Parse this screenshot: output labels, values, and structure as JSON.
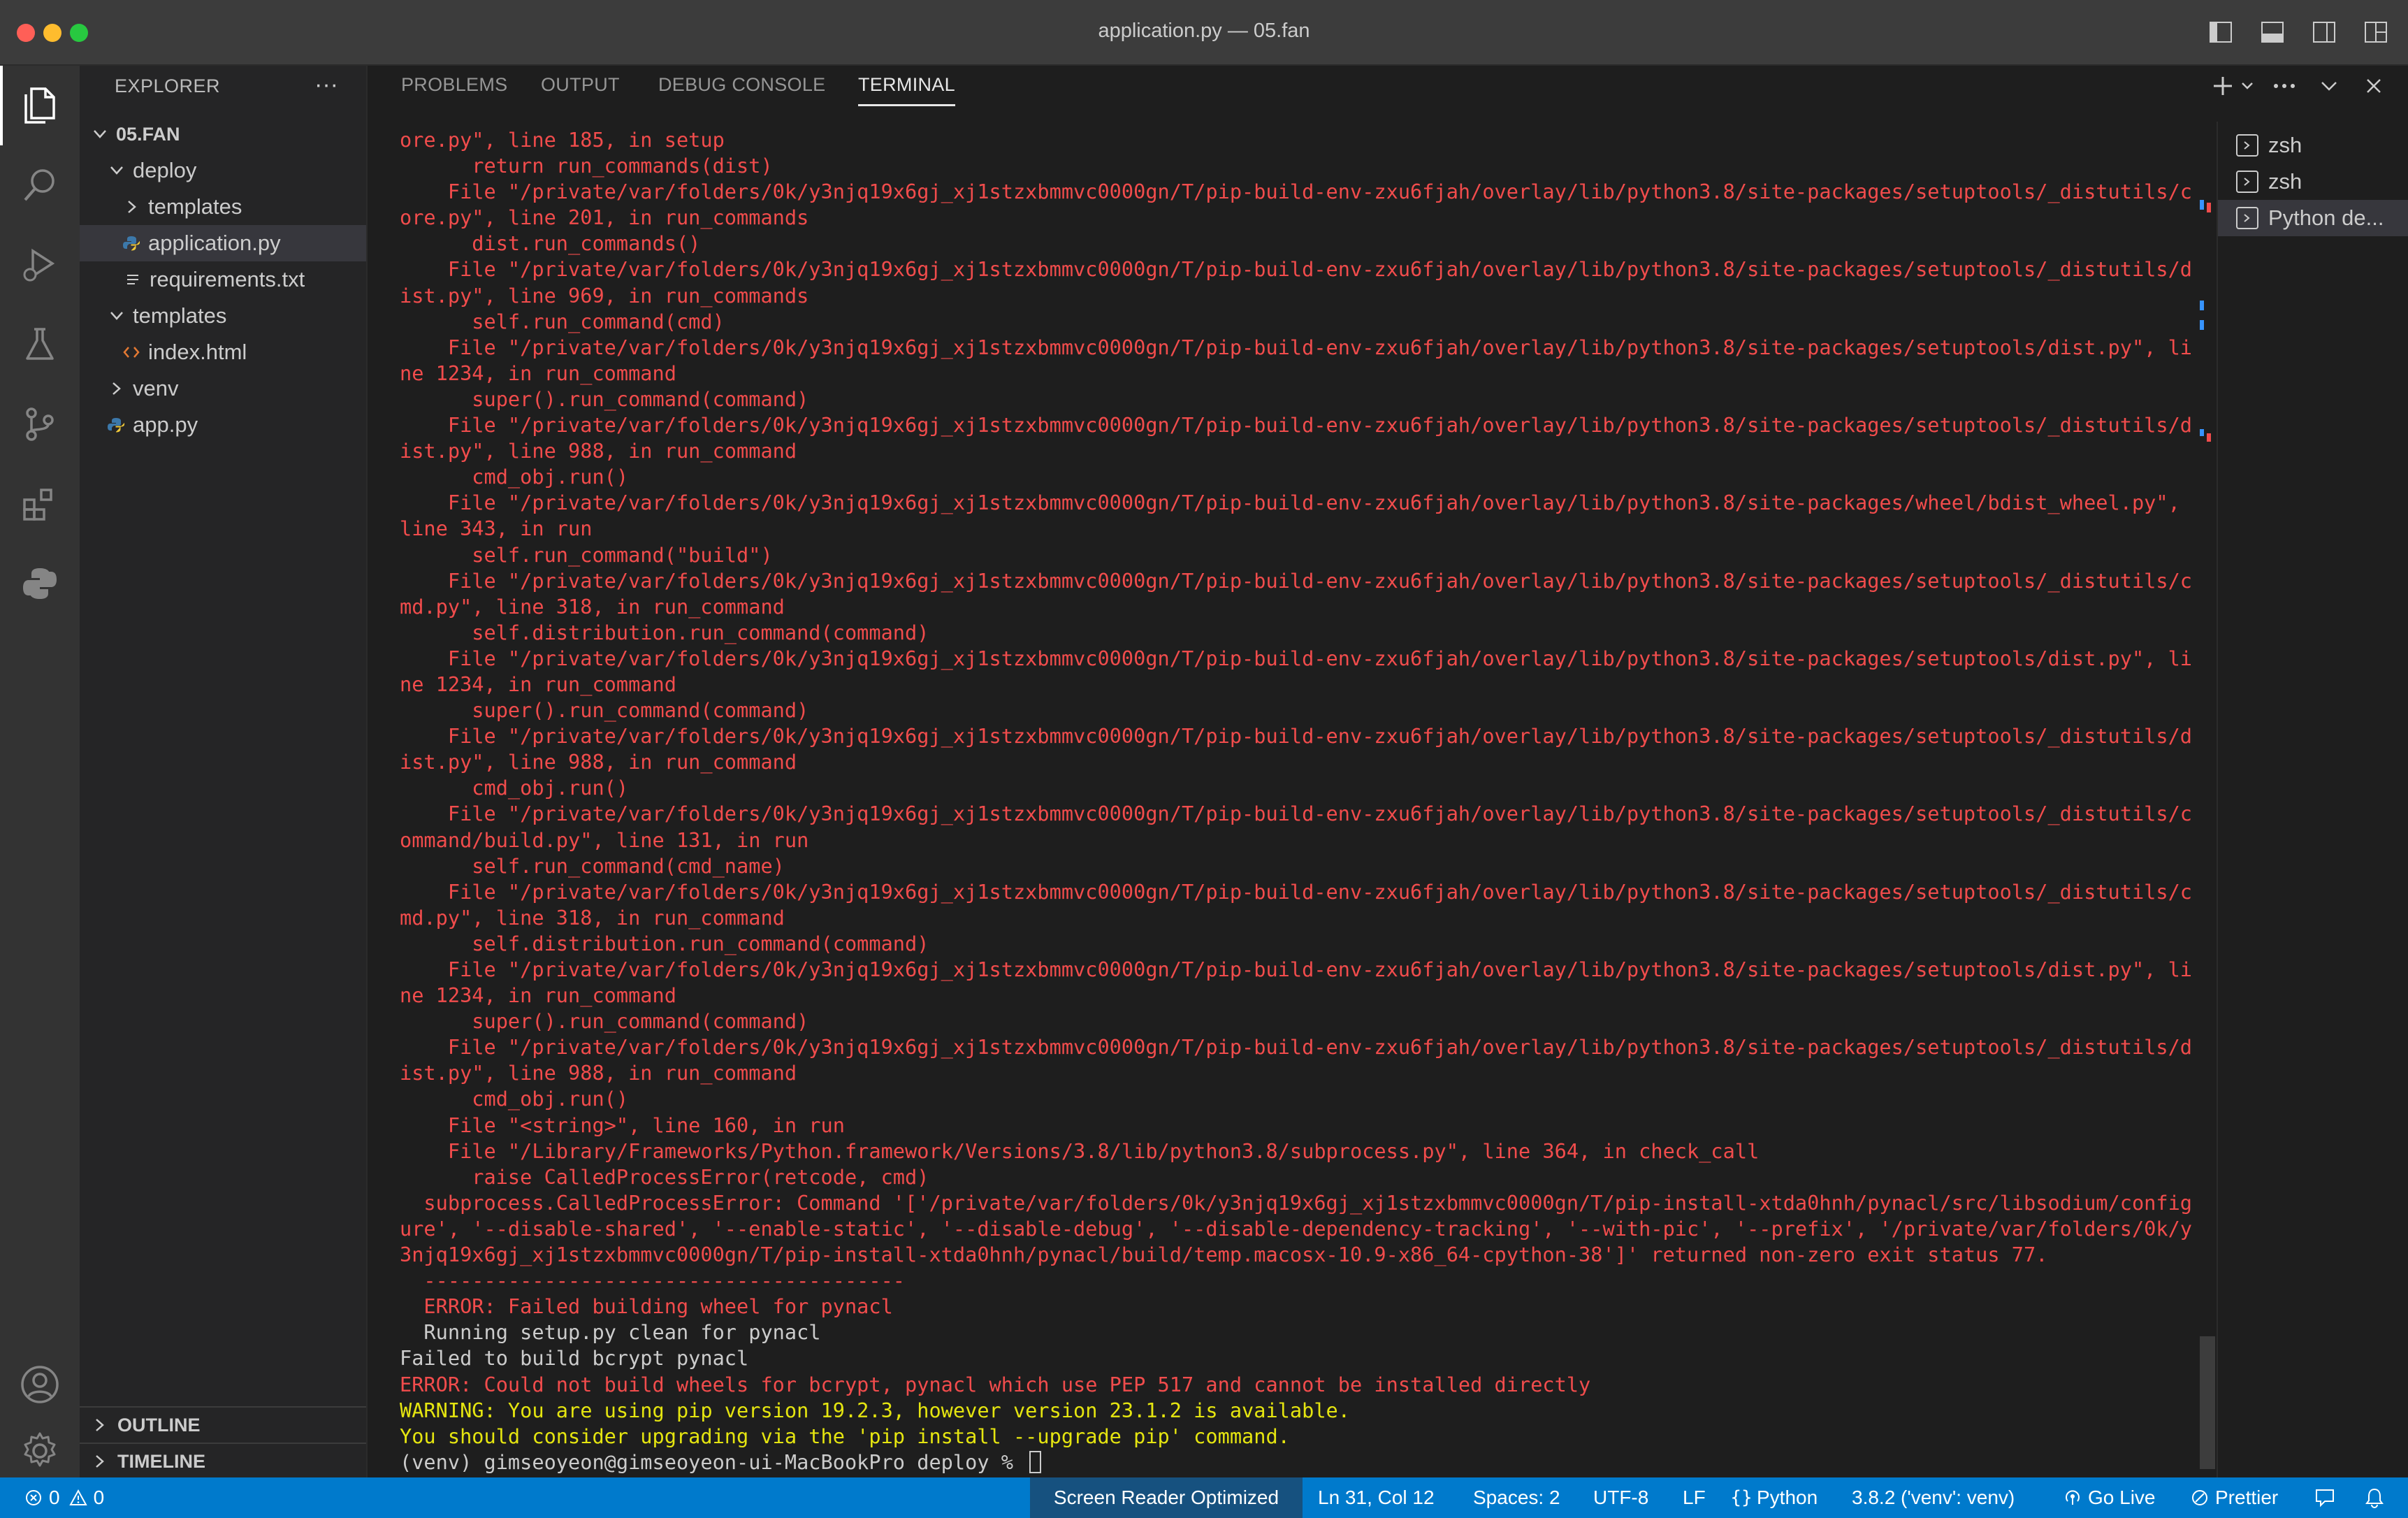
{
  "window": {
    "title": "application.py — 05.fan"
  },
  "sidebar": {
    "title": "EXPLORER",
    "more": "···",
    "root": "05.FAN",
    "tree": [
      {
        "label": "deploy",
        "kind": "folder-open"
      },
      {
        "label": "templates",
        "kind": "folder-closed"
      },
      {
        "label": "application.py",
        "kind": "python-file"
      },
      {
        "label": "requirements.txt",
        "kind": "text-file"
      },
      {
        "label": "templates",
        "kind": "folder-open"
      },
      {
        "label": "index.html",
        "kind": "html-file"
      },
      {
        "label": "venv",
        "kind": "folder-closed"
      },
      {
        "label": "app.py",
        "kind": "python-file"
      }
    ],
    "outline": "OUTLINE",
    "timeline": "TIMELINE"
  },
  "panel": {
    "tabs": [
      "PROBLEMS",
      "OUTPUT",
      "DEBUG CONSOLE",
      "TERMINAL"
    ],
    "active_tab": "TERMINAL",
    "terminals": [
      "zsh",
      "zsh",
      "Python de..."
    ]
  },
  "terminal": {
    "lines": [
      {
        "t": "ore.py\", line 185, in setup",
        "c": "err"
      },
      {
        "t": "      return run_commands(dist)",
        "c": "err"
      },
      {
        "t": "    File \"/private/var/folders/0k/y3njq19x6gj_xj1stzxbmmvc0000gn/T/pip-build-env-zxu6fjah/overlay/lib/python3.8/site-packages/setuptools/_distutils/c",
        "c": "err"
      },
      {
        "t": "ore.py\", line 201, in run_commands",
        "c": "err"
      },
      {
        "t": "      dist.run_commands()",
        "c": "err"
      },
      {
        "t": "    File \"/private/var/folders/0k/y3njq19x6gj_xj1stzxbmmvc0000gn/T/pip-build-env-zxu6fjah/overlay/lib/python3.8/site-packages/setuptools/_distutils/d",
        "c": "err"
      },
      {
        "t": "ist.py\", line 969, in run_commands",
        "c": "err"
      },
      {
        "t": "      self.run_command(cmd)",
        "c": "err"
      },
      {
        "t": "    File \"/private/var/folders/0k/y3njq19x6gj_xj1stzxbmmvc0000gn/T/pip-build-env-zxu6fjah/overlay/lib/python3.8/site-packages/setuptools/dist.py\", li",
        "c": "err"
      },
      {
        "t": "ne 1234, in run_command",
        "c": "err"
      },
      {
        "t": "      super().run_command(command)",
        "c": "err"
      },
      {
        "t": "    File \"/private/var/folders/0k/y3njq19x6gj_xj1stzxbmmvc0000gn/T/pip-build-env-zxu6fjah/overlay/lib/python3.8/site-packages/setuptools/_distutils/d",
        "c": "err"
      },
      {
        "t": "ist.py\", line 988, in run_command",
        "c": "err"
      },
      {
        "t": "      cmd_obj.run()",
        "c": "err"
      },
      {
        "t": "    File \"/private/var/folders/0k/y3njq19x6gj_xj1stzxbmmvc0000gn/T/pip-build-env-zxu6fjah/overlay/lib/python3.8/site-packages/wheel/bdist_wheel.py\",",
        "c": "err"
      },
      {
        "t": "line 343, in run",
        "c": "err"
      },
      {
        "t": "      self.run_command(\"build\")",
        "c": "err"
      },
      {
        "t": "    File \"/private/var/folders/0k/y3njq19x6gj_xj1stzxbmmvc0000gn/T/pip-build-env-zxu6fjah/overlay/lib/python3.8/site-packages/setuptools/_distutils/c",
        "c": "err"
      },
      {
        "t": "md.py\", line 318, in run_command",
        "c": "err"
      },
      {
        "t": "      self.distribution.run_command(command)",
        "c": "err"
      },
      {
        "t": "    File \"/private/var/folders/0k/y3njq19x6gj_xj1stzxbmmvc0000gn/T/pip-build-env-zxu6fjah/overlay/lib/python3.8/site-packages/setuptools/dist.py\", li",
        "c": "err"
      },
      {
        "t": "ne 1234, in run_command",
        "c": "err"
      },
      {
        "t": "      super().run_command(command)",
        "c": "err"
      },
      {
        "t": "    File \"/private/var/folders/0k/y3njq19x6gj_xj1stzxbmmvc0000gn/T/pip-build-env-zxu6fjah/overlay/lib/python3.8/site-packages/setuptools/_distutils/d",
        "c": "err"
      },
      {
        "t": "ist.py\", line 988, in run_command",
        "c": "err"
      },
      {
        "t": "      cmd_obj.run()",
        "c": "err"
      },
      {
        "t": "    File \"/private/var/folders/0k/y3njq19x6gj_xj1stzxbmmvc0000gn/T/pip-build-env-zxu6fjah/overlay/lib/python3.8/site-packages/setuptools/_distutils/c",
        "c": "err"
      },
      {
        "t": "ommand/build.py\", line 131, in run",
        "c": "err"
      },
      {
        "t": "      self.run_command(cmd_name)",
        "c": "err"
      },
      {
        "t": "    File \"/private/var/folders/0k/y3njq19x6gj_xj1stzxbmmvc0000gn/T/pip-build-env-zxu6fjah/overlay/lib/python3.8/site-packages/setuptools/_distutils/c",
        "c": "err"
      },
      {
        "t": "md.py\", line 318, in run_command",
        "c": "err"
      },
      {
        "t": "      self.distribution.run_command(command)",
        "c": "err"
      },
      {
        "t": "    File \"/private/var/folders/0k/y3njq19x6gj_xj1stzxbmmvc0000gn/T/pip-build-env-zxu6fjah/overlay/lib/python3.8/site-packages/setuptools/dist.py\", li",
        "c": "err"
      },
      {
        "t": "ne 1234, in run_command",
        "c": "err"
      },
      {
        "t": "      super().run_command(command)",
        "c": "err"
      },
      {
        "t": "    File \"/private/var/folders/0k/y3njq19x6gj_xj1stzxbmmvc0000gn/T/pip-build-env-zxu6fjah/overlay/lib/python3.8/site-packages/setuptools/_distutils/d",
        "c": "err"
      },
      {
        "t": "ist.py\", line 988, in run_command",
        "c": "err"
      },
      {
        "t": "      cmd_obj.run()",
        "c": "err"
      },
      {
        "t": "    File \"<string>\", line 160, in run",
        "c": "err"
      },
      {
        "t": "    File \"/Library/Frameworks/Python.framework/Versions/3.8/lib/python3.8/subprocess.py\", line 364, in check_call",
        "c": "err"
      },
      {
        "t": "      raise CalledProcessError(retcode, cmd)",
        "c": "err"
      },
      {
        "t": "  subprocess.CalledProcessError: Command '['/private/var/folders/0k/y3njq19x6gj_xj1stzxbmmvc0000gn/T/pip-install-xtda0hnh/pynacl/src/libsodium/config",
        "c": "err"
      },
      {
        "t": "ure', '--disable-shared', '--enable-static', '--disable-debug', '--disable-dependency-tracking', '--with-pic', '--prefix', '/private/var/folders/0k/y",
        "c": "err"
      },
      {
        "t": "3njq19x6gj_xj1stzxbmmvc0000gn/T/pip-install-xtda0hnh/pynacl/build/temp.macosx-10.9-x86_64-cpython-38']' returned non-zero exit status 77.",
        "c": "err"
      },
      {
        "t": "  ----------------------------------------",
        "c": "err"
      },
      {
        "t": "  ERROR: Failed building wheel for pynacl",
        "c": "err"
      },
      {
        "t": "  Running setup.py clean for pynacl",
        "c": "norm"
      },
      {
        "t": "Failed to build bcrypt pynacl",
        "c": "norm"
      },
      {
        "t": "ERROR: Could not build wheels for bcrypt, pynacl which use PEP 517 and cannot be installed directly",
        "c": "err"
      },
      {
        "t": "WARNING: You are using pip version 19.2.3, however version 23.1.2 is available.",
        "c": "warn"
      },
      {
        "t": "You should consider upgrading via the 'pip install --upgrade pip' command.",
        "c": "warn"
      },
      {
        "t": "(venv) gimseoyeon@gimseoyeon-ui-MacBookPro deploy % ",
        "c": "norm"
      }
    ]
  },
  "statusbar": {
    "errors": "0",
    "warnings": "0",
    "screen_reader": "Screen Reader Optimized",
    "position": "Ln 31, Col 12",
    "spaces": "Spaces: 2",
    "encoding": "UTF-8",
    "eol": "LF",
    "language": "Python",
    "interpreter": "3.8.2 ('venv': venv)",
    "go_live": "Go Live",
    "prettier": "Prettier"
  },
  "colors": {
    "statusbar": "#007acc",
    "terminal_error": "#f14c4c",
    "terminal_warning": "#e5e510"
  }
}
